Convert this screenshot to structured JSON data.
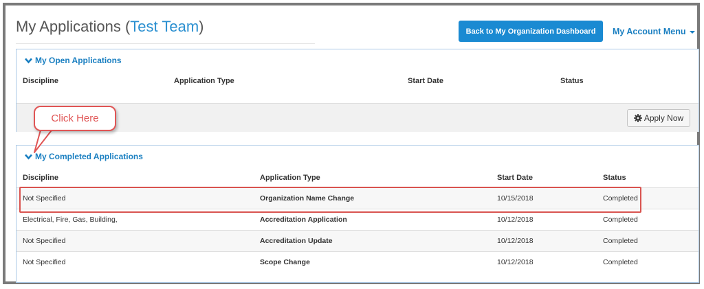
{
  "header": {
    "title_prefix": "My Applications (",
    "title_team": "Test Team",
    "title_suffix": ")",
    "dashboard_button": "Back to My Organization Dashboard",
    "account_menu": "My Account Menu"
  },
  "open_applications": {
    "heading": "My Open Applications",
    "columns": [
      "Discipline",
      "Application Type",
      "Start Date",
      "Status"
    ],
    "apply_button": "Apply Now"
  },
  "annotation": {
    "callout": "Click Here"
  },
  "completed_applications": {
    "heading": "My Completed Applications",
    "columns": [
      "Discipline",
      "Application Type",
      "Start Date",
      "Status"
    ],
    "rows": [
      {
        "discipline": "Not Specified",
        "type": "Organization Name Change",
        "start": "10/15/2018",
        "status": "Completed"
      },
      {
        "discipline": "Electrical, Fire, Gas, Building,",
        "type": "Accreditation Application",
        "start": "10/12/2018",
        "status": "Completed"
      },
      {
        "discipline": "Not Specified",
        "type": "Accreditation Update",
        "start": "10/12/2018",
        "status": "Completed"
      },
      {
        "discipline": "Not Specified",
        "type": "Scope Change",
        "start": "10/12/2018",
        "status": "Completed"
      }
    ]
  },
  "colors": {
    "accent": "#1a8ad2",
    "link": "#1a7fc1",
    "annotation": "#e05555"
  },
  "icons": {
    "heading_toggle": "chevron-down-icon",
    "apply": "gear-icon",
    "menu": "caret-down-icon"
  }
}
